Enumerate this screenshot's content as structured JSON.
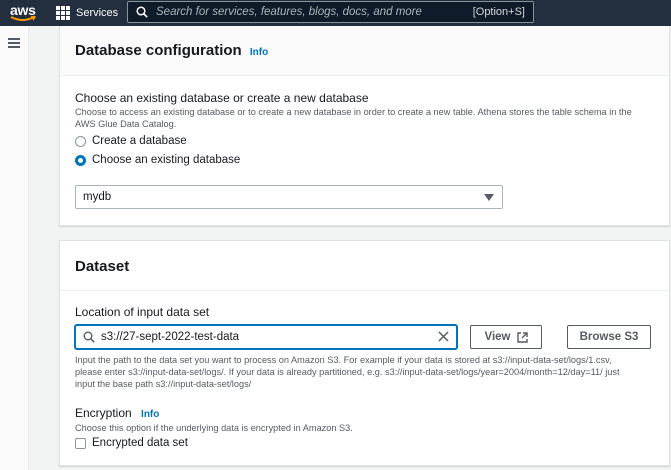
{
  "topnav": {
    "logo_text": "aws",
    "services_label": "Services",
    "search_placeholder": "Search for services, features, blogs, docs, and more",
    "search_shortcut": "[Option+S]"
  },
  "database_config": {
    "title": "Database configuration",
    "info_label": "Info",
    "choose_label": "Choose an existing database or create a new database",
    "choose_desc_line1": "Choose to access an existing database or to create a new database in order to create a new table. Athena stores the table schema in the",
    "choose_desc_line2": "AWS Glue Data Catalog.",
    "options": [
      {
        "label": "Create a database",
        "selected": false
      },
      {
        "label": "Choose an existing database",
        "selected": true
      }
    ],
    "selected_database": "mydb"
  },
  "dataset": {
    "title": "Dataset",
    "location_label": "Location of input data set",
    "location_value": "s3://27-sept-2022-test-data",
    "view_button": "View",
    "browse_button": "Browse S3",
    "location_desc_line1": "Input the path to the data set you want to process on Amazon S3. For example if your data is stored at s3://input-data-set/logs/1.csv,",
    "location_desc_line2": "please enter s3://input-data-set/logs/. If your data is already partitioned, e.g. s3://input-data-set/logs/year=2004/month=12/day=11/ just",
    "location_desc_line3": "input the base path s3://input-data-set/logs/",
    "encryption_label": "Encryption",
    "encryption_info": "Info",
    "encryption_desc": "Choose this option if the underlying data is encrypted in Amazon S3.",
    "encrypted_checkbox_label": "Encrypted data set",
    "encrypted_checked": false
  },
  "colors": {
    "nav_bg": "#232f3e",
    "accent": "#0073bb",
    "logo_smile": "#ff9900"
  }
}
